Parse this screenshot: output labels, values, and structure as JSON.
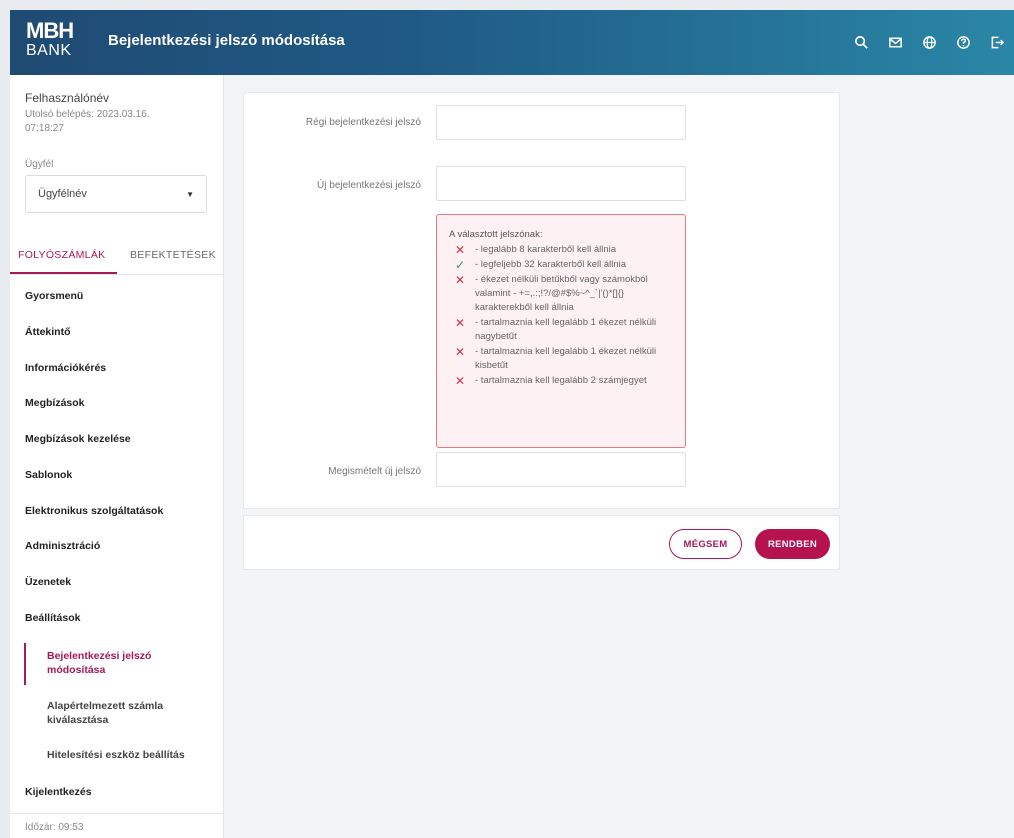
{
  "header": {
    "logo_line1": "MBH",
    "logo_line2": "BANK",
    "title": "Bejelentkezési jelszó módosítása",
    "icons": [
      "search-icon",
      "mail-icon",
      "globe-icon",
      "help-icon",
      "logout-icon"
    ]
  },
  "sidebar": {
    "user_name": "Felhasználónév",
    "last_login": "Utolsó belépés: 2023.03.16. 07:18:27",
    "client_label": "Ügyfél",
    "client_value": "Ügyfélnév",
    "tabs": [
      {
        "label": "FOLYÓSZÁMLÁK",
        "active": true
      },
      {
        "label": "BEFEKTETÉSEK",
        "active": false
      }
    ],
    "nav": [
      {
        "label": "Gyorsmenü"
      },
      {
        "label": "Áttekintő"
      },
      {
        "label": "Információkérés"
      },
      {
        "label": "Megbízások"
      },
      {
        "label": "Megbízások kezelése"
      },
      {
        "label": "Sablonok"
      },
      {
        "label": "Elektronikus szolgáltatások"
      },
      {
        "label": "Adminisztráció"
      },
      {
        "label": "Üzenetek"
      },
      {
        "label": "Beállítások"
      }
    ],
    "subnav": [
      {
        "label": "Bejelentkezési jelszó módosítása",
        "active": true
      },
      {
        "label": "Alapértelmezett számla kiválasztása",
        "active": false
      },
      {
        "label": "Hitelesítési eszköz beállítás",
        "active": false
      }
    ],
    "logout_label": "Kijelentkezés",
    "timer": "Időzár: 09:53"
  },
  "form": {
    "old_password_label": "Régi bejelentkezési jelszó",
    "new_password_label": "Új bejelentkezési jelszó",
    "repeat_password_label": "Megismételt új jelszó",
    "old_password_value": "",
    "new_password_value": "",
    "repeat_password_value": "",
    "rules_title": "A választott jelszónak:",
    "rules": [
      {
        "status": "fail",
        "text": "- legalább 8 karakterből kell állnia"
      },
      {
        "status": "ok",
        "text": "- legfeljebb 32 karakterből kell állnia"
      },
      {
        "status": "fail",
        "text": "- ékezet nélküli betűkből vagy számokból valamint - +=,.:;!?/@#$%~^_`|'()*[]{} karakterekből kell állnia"
      },
      {
        "status": "fail",
        "text": "- tartalmaznia kell legalább 1 ékezet nélküli nagybetűt"
      },
      {
        "status": "fail",
        "text": "- tartalmaznia kell legalább 1 ékezet nélküli kisbetűt"
      },
      {
        "status": "fail",
        "text": "- tartalmaznia kell legalább 2 számjegyet"
      }
    ]
  },
  "actions": {
    "cancel_label": "MÉGSEM",
    "ok_label": "RENDBEN"
  },
  "colors": {
    "accent": "#a6195b",
    "header_start": "#1f4a72",
    "header_end": "#2a86a6",
    "rule_fail": "#d3314a",
    "rule_ok": "#3a9a5a"
  }
}
